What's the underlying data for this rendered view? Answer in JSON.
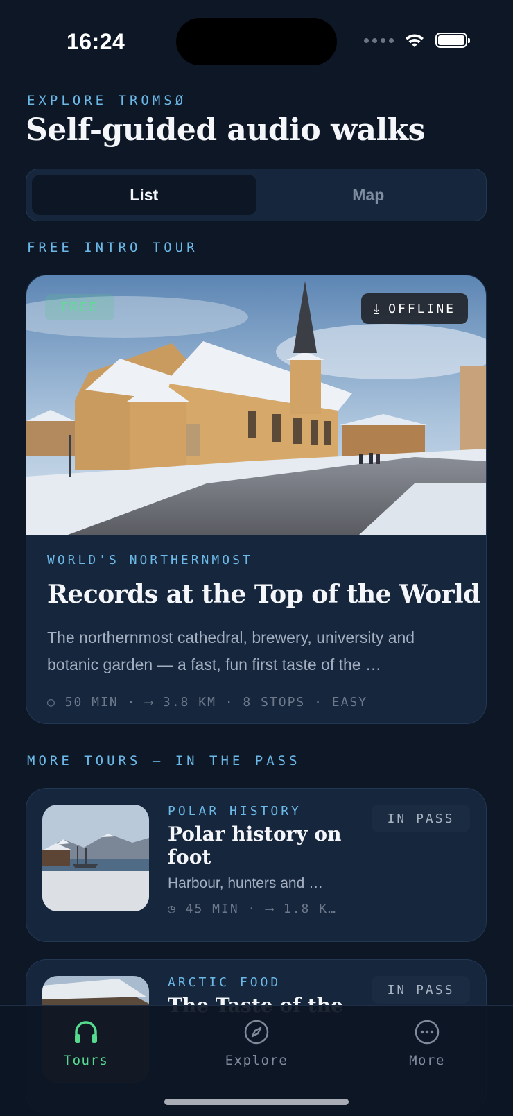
{
  "status_bar": {
    "time": "16:24"
  },
  "header": {
    "eyebrow": "EXPLORE TROMSØ",
    "title": "Self-guided audio walks"
  },
  "view_toggle": {
    "options": [
      "List",
      "Map"
    ],
    "selected": "List"
  },
  "free_section": {
    "label": "FREE INTRO TOUR"
  },
  "hero_tour": {
    "badge_free": "FREE",
    "badge_offline": "OFFLINE",
    "badge_offline_icon": "download-icon",
    "eyebrow": "WORLD'S NORTHERNMOST",
    "title": "Records at the Top of the World",
    "description": "The northernmost cathedral, brewery, university and botanic garden — a fast, fun first taste of the …",
    "meta": "◷ 50 MIN · ⟶ 3.8 KM · 8 STOPS · EASY"
  },
  "more_section": {
    "label": "MORE TOURS — IN THE PASS"
  },
  "tours": [
    {
      "eyebrow": "POLAR HISTORY",
      "title": "Polar history on foot",
      "description": "Harbour, hunters and …",
      "meta": "◷ 45 MIN · ⟶ 1.8 K…",
      "badge": "IN PASS"
    },
    {
      "eyebrow": "ARCTIC FOOD",
      "title": "The Taste of the",
      "badge": "IN PASS"
    }
  ],
  "tab_bar": {
    "tabs": [
      {
        "label": "Tours",
        "icon": "headphones-icon",
        "active": true
      },
      {
        "label": "Explore",
        "icon": "compass-icon",
        "active": false
      },
      {
        "label": "More",
        "icon": "more-icon",
        "active": false
      }
    ]
  },
  "colors": {
    "background": "#0d1726",
    "card": "#16263d",
    "accent_blue": "#6cb9e8",
    "accent_green": "#56db8e"
  }
}
